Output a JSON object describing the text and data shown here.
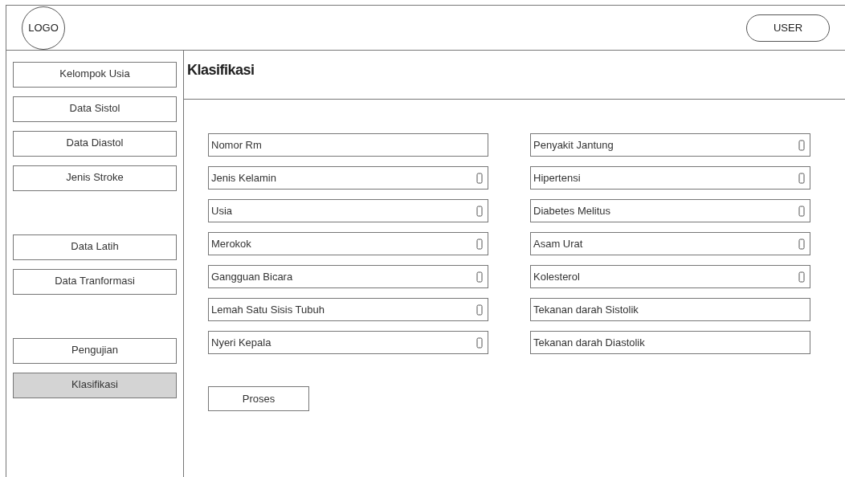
{
  "header": {
    "logo": "LOGO",
    "user_button": "USER"
  },
  "sidebar": {
    "groups": [
      [
        {
          "label": "Kelompok Usia",
          "selected": false
        },
        {
          "label": "Data Sistol",
          "selected": false
        },
        {
          "label": "Data Diastol",
          "selected": false
        },
        {
          "label": "Jenis Stroke",
          "selected": false
        }
      ],
      [
        {
          "label": "Data Latih",
          "selected": false
        },
        {
          "label": "Data Tranformasi",
          "selected": false
        }
      ],
      [
        {
          "label": "Pengujian",
          "selected": false
        },
        {
          "label": "Klasifikasi",
          "selected": true
        }
      ]
    ]
  },
  "content": {
    "title": "Klasifikasi",
    "left_fields": [
      {
        "label": "Nomor Rm",
        "kind": "text"
      },
      {
        "label": "Jenis Kelamin",
        "kind": "select"
      },
      {
        "label": "Usia",
        "kind": "select"
      },
      {
        "label": "Merokok",
        "kind": "select"
      },
      {
        "label": "Gangguan Bicara",
        "kind": "select"
      },
      {
        "label": "Lemah Satu Sisis Tubuh",
        "kind": "select"
      },
      {
        "label": "Nyeri Kepala",
        "kind": "select"
      }
    ],
    "right_fields": [
      {
        "label": "Penyakit Jantung",
        "kind": "select"
      },
      {
        "label": "Hipertensi",
        "kind": "select"
      },
      {
        "label": "Diabetes Melitus",
        "kind": "select"
      },
      {
        "label": "Asam Urat",
        "kind": "select"
      },
      {
        "label": "Kolesterol",
        "kind": "select"
      },
      {
        "label": "Tekanan darah Sistolik",
        "kind": "text"
      },
      {
        "label": "Tekanan darah Diastolik",
        "kind": "text"
      }
    ],
    "submit_button": "Proses"
  }
}
